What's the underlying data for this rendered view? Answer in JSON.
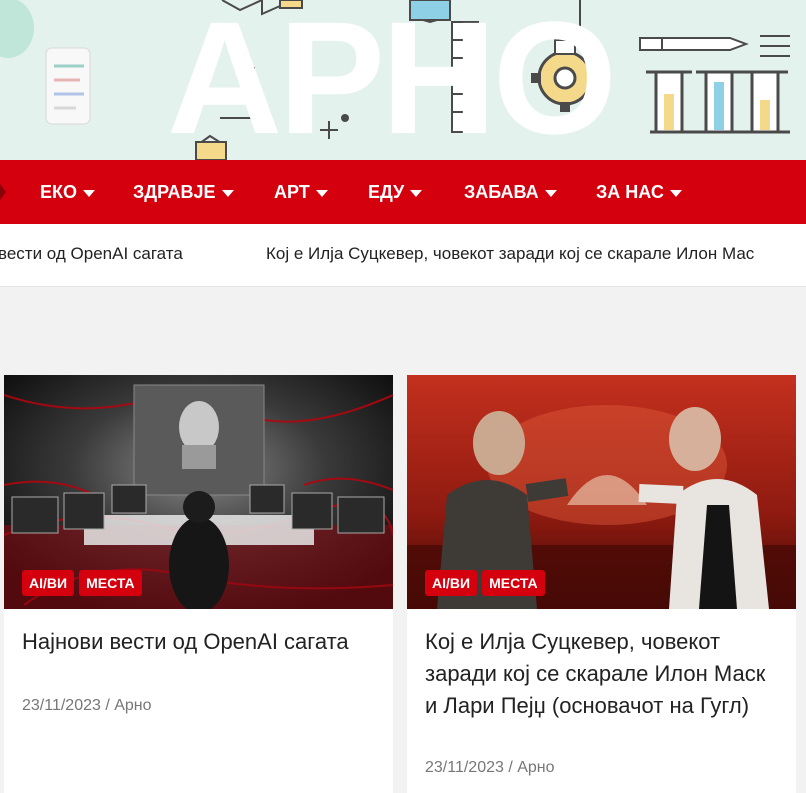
{
  "site": {
    "logo_text": "АРНО"
  },
  "nav": {
    "items": [
      {
        "label": "ЕКО"
      },
      {
        "label": "ЗДРАВЈЕ"
      },
      {
        "label": "АРТ"
      },
      {
        "label": "ЕДУ"
      },
      {
        "label": "ЗАБАВА"
      },
      {
        "label": "ЗА НАС"
      }
    ]
  },
  "ticker": {
    "items": [
      "вести од OpenAI сагата",
      "Кој е Илја Суцкевер, човекот заради кој се скарале Илон Мас"
    ]
  },
  "posts": [
    {
      "tags": [
        "AI/ВИ",
        "МЕСТА"
      ],
      "title": "Најнови вести од OpenAI сагата",
      "date": "23/11/2023",
      "separator": "/",
      "author": "Арно"
    },
    {
      "tags": [
        "AI/ВИ",
        "МЕСТА"
      ],
      "title": "Кој е Илја Суцкевер, човекот заради кој се скарале Илон Маск и Лари Пејџ (основачот на Гугл)",
      "date": "23/11/2023",
      "separator": "/",
      "author": "Арно"
    }
  ],
  "colors": {
    "accent": "#d4000e",
    "page_bg": "#f2f2f2",
    "banner_bg": "#e4f2ee"
  }
}
